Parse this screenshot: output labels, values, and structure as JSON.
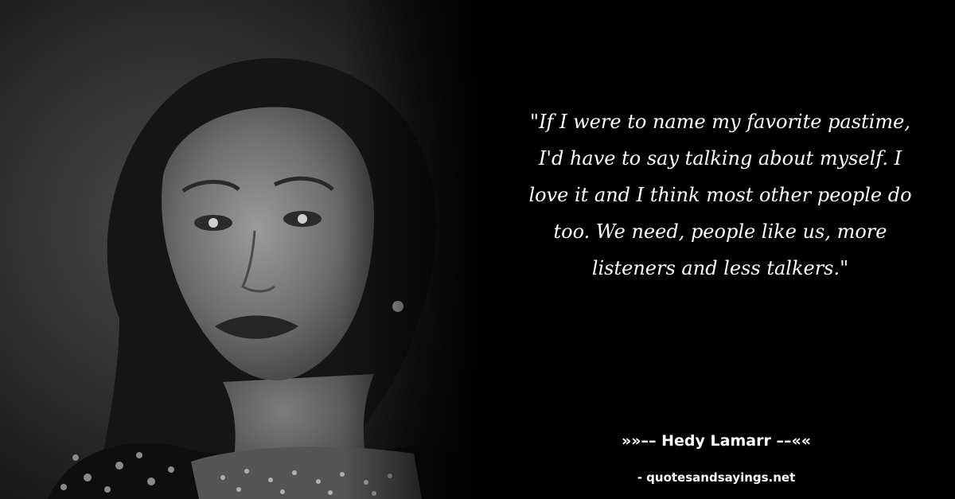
{
  "quote": {
    "text": "\"If I were to name my favorite pastime, I'd have to say talking about myself. I love it and I think most other people do too. We need, people like us, more listeners and less talkers.\""
  },
  "attribution": {
    "author_line": "»»–– Hedy Lamarr ––««",
    "source_line": "- quotesandsayings.net"
  },
  "colors": {
    "background": "#000000",
    "text": "#ffffff"
  }
}
